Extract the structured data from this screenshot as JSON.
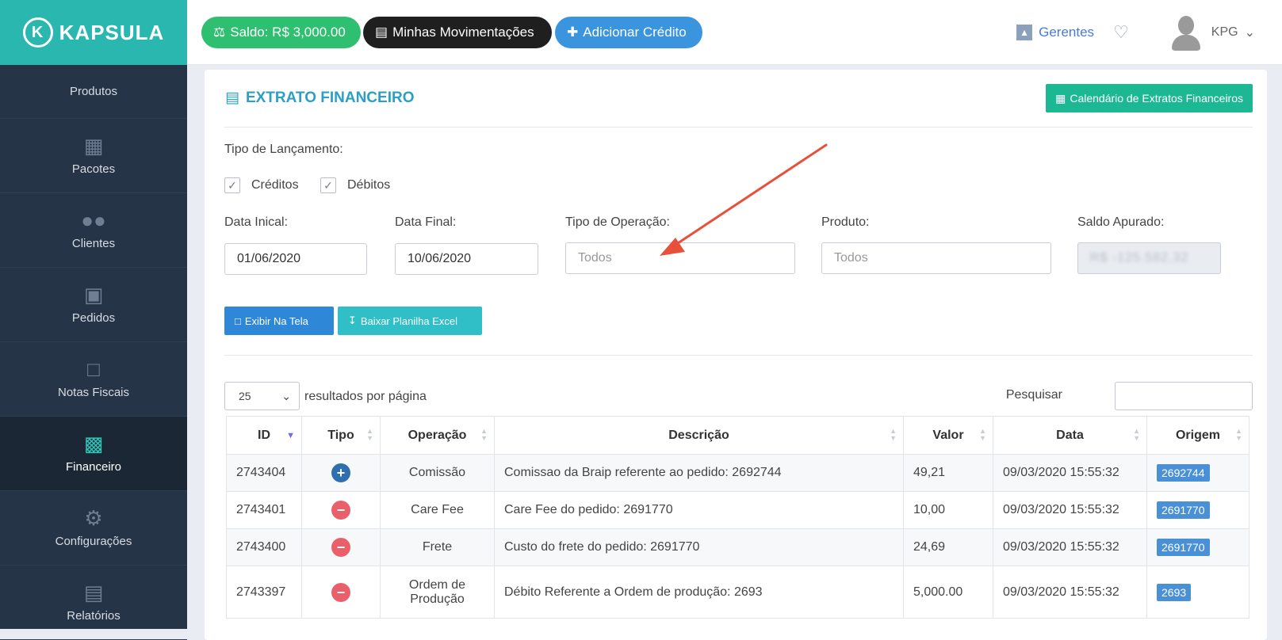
{
  "brand": {
    "name": "KAPSULA",
    "logo_letter": "K"
  },
  "sidebar": {
    "items": [
      {
        "label": "Produtos",
        "icon": "box-icon",
        "active": false
      },
      {
        "label": "Pacotes",
        "icon": "cubes-icon",
        "active": false
      },
      {
        "label": "Clientes",
        "icon": "users-icon",
        "active": false
      },
      {
        "label": "Pedidos",
        "icon": "cart-icon",
        "active": false
      },
      {
        "label": "Notas Fiscais",
        "icon": "pdf-file-icon",
        "active": false
      },
      {
        "label": "Financeiro",
        "icon": "money-icon",
        "active": true
      },
      {
        "label": "Configurações",
        "icon": "gear-icon",
        "active": false
      },
      {
        "label": "Relatórios",
        "icon": "notebook-icon",
        "active": false
      }
    ]
  },
  "topbar": {
    "saldo": "Saldo: R$ 3,000.00",
    "movimentacoes": "Minhas Movimentações",
    "adicionar": "Adicionar Crédito",
    "gerentes": "Gerentes",
    "user": "KPG"
  },
  "page": {
    "title": "EXTRATO FINANCEIRO",
    "calendar_button": "Calendário de Extratos Financeiros",
    "tipo_lancamento_label": "Tipo de Lançamento:",
    "creditos_label": "Créditos",
    "debitos_label": "Débitos",
    "data_inicial_label": "Data Inical:",
    "data_inicial_value": "01/06/2020",
    "data_final_label": "Data Final:",
    "data_final_value": "10/06/2020",
    "tipo_operacao_label": "Tipo de Operação:",
    "tipo_operacao_placeholder": "Todos",
    "produto_label": "Produto:",
    "produto_placeholder": "Todos",
    "saldo_apurado_label": "Saldo Apurado:",
    "saldo_apurado_value": "R$ -125.582,32",
    "exibir_button": "Exibir Na Tela",
    "baixar_button": "Baixar Planilha Excel",
    "page_size": "25",
    "per_page_label": "resultados por página",
    "search_label": "Pesquisar"
  },
  "table": {
    "headers": [
      "ID",
      "Tipo",
      "Operação",
      "Descrição",
      "Valor",
      "Data",
      "Origem"
    ],
    "rows": [
      {
        "id": "2743404",
        "tipo": "credit",
        "operacao": "Comissão",
        "descricao": "Comissao da Braip referente ao pedido: 2692744",
        "valor": "49,21",
        "data": "09/03/2020 15:55:32",
        "origem": "2692744"
      },
      {
        "id": "2743401",
        "tipo": "debit",
        "operacao": "Care Fee",
        "descricao": "Care Fee do pedido: 2691770",
        "valor": "10,00",
        "data": "09/03/2020 15:55:32",
        "origem": "2691770"
      },
      {
        "id": "2743400",
        "tipo": "debit",
        "operacao": "Frete",
        "descricao": "Custo do frete do pedido: 2691770",
        "valor": "24,69",
        "data": "09/03/2020 15:55:32",
        "origem": "2691770"
      },
      {
        "id": "2743397",
        "tipo": "debit",
        "operacao": "Ordem de Produção",
        "descricao": "Débito Referente a Ordem de produção: 2693",
        "valor": "5,000.00",
        "data": "09/03/2020 15:55:32",
        "origem": "2693"
      }
    ]
  },
  "colors": {
    "brand": "#29b7b0",
    "sidebar": "#263447",
    "accent_blue": "#3a95de",
    "annotation_arrow": "#e8503a"
  }
}
